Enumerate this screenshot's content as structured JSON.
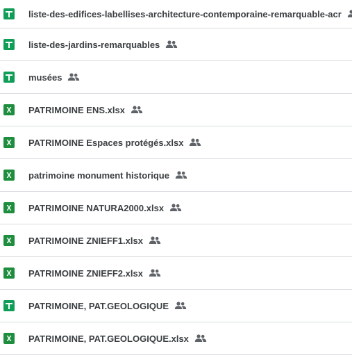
{
  "colors": {
    "sheets_green": "#0f9d58",
    "excel_green": "#1e8e3e",
    "text": "#3c4043",
    "shared_icon": "#5f6368",
    "divider": "#dadce0"
  },
  "files": [
    {
      "name": "liste-des-edifices-labellises-architecture-contemporaine-remarquable-acr",
      "type": "google-sheets",
      "icon": "google-sheets-icon",
      "shared": true
    },
    {
      "name": "liste-des-jardins-remarquables",
      "type": "google-sheets",
      "icon": "google-sheets-icon",
      "shared": true
    },
    {
      "name": "musées",
      "type": "google-sheets",
      "icon": "google-sheets-icon",
      "shared": true
    },
    {
      "name": "PATRIMOINE ENS.xlsx",
      "type": "excel",
      "icon": "excel-icon",
      "shared": true
    },
    {
      "name": "PATRIMOINE Espaces protégés.xlsx",
      "type": "excel",
      "icon": "excel-icon",
      "shared": true
    },
    {
      "name": "patrimoine monument historique",
      "type": "excel",
      "icon": "excel-icon",
      "shared": true
    },
    {
      "name": "PATRIMOINE NATURA2000.xlsx",
      "type": "excel",
      "icon": "excel-icon",
      "shared": true
    },
    {
      "name": "PATRIMOINE ZNIEFF1.xlsx",
      "type": "excel",
      "icon": "excel-icon",
      "shared": true
    },
    {
      "name": "PATRIMOINE ZNIEFF2.xlsx",
      "type": "excel",
      "icon": "excel-icon",
      "shared": true
    },
    {
      "name": "PATRIMOINE, PAT.GEOLOGIQUE",
      "type": "google-sheets",
      "icon": "google-sheets-icon",
      "shared": true
    },
    {
      "name": "PATRIMOINE, PAT.GEOLOGIQUE.xlsx",
      "type": "excel",
      "icon": "excel-icon",
      "shared": true
    }
  ]
}
